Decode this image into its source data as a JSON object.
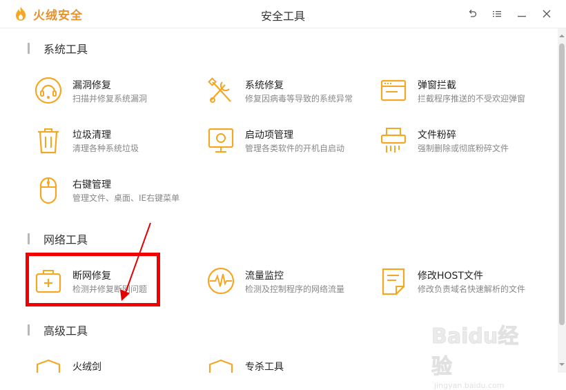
{
  "app": {
    "brand_name": "火绒安全",
    "window_title": "安全工具"
  },
  "titlebar": {
    "controls": [
      {
        "name": "back-icon"
      },
      {
        "name": "menu-icon"
      },
      {
        "name": "minimize-icon"
      },
      {
        "name": "close-icon"
      }
    ]
  },
  "sections": [
    {
      "title": "系统工具",
      "tools": [
        {
          "name": "漏洞修复",
          "desc": "扫描并修复系统漏洞",
          "icon": "vulnerability-fix-icon"
        },
        {
          "name": "系统修复",
          "desc": "修复因病毒等导致的系统异常",
          "icon": "tools-wrench-icon"
        },
        {
          "name": "弹窗拦截",
          "desc": "拦截程序推送的不受欢迎弹窗",
          "icon": "popup-window-icon"
        },
        {
          "name": "垃圾清理",
          "desc": "清理各种系统垃圾",
          "icon": "trash-icon"
        },
        {
          "name": "启动项管理",
          "desc": "管理各类软件的开机自启动",
          "icon": "monitor-icon"
        },
        {
          "name": "文件粉碎",
          "desc": "强制删除或彻底粉碎文件",
          "icon": "shredder-icon"
        },
        {
          "name": "右键管理",
          "desc": "管理文件、桌面、IE右键菜单",
          "icon": "mouse-icon"
        }
      ]
    },
    {
      "title": "网络工具",
      "tools": [
        {
          "name": "断网修复",
          "desc": "检测并修复断网问题",
          "icon": "toolbox-icon"
        },
        {
          "name": "流量监控",
          "desc": "检测及控制程序的网络流量",
          "icon": "traffic-pulse-icon"
        },
        {
          "name": "修改HOST文件",
          "desc": "修改负责域名快速解析的文件",
          "icon": "document-icon"
        }
      ]
    },
    {
      "title": "高级工具",
      "tools": [
        {
          "name": "火绒剑",
          "desc": "",
          "icon": "shield-icon"
        },
        {
          "name": "专杀工具",
          "desc": "",
          "icon": "shield-icon"
        }
      ]
    }
  ],
  "watermark": {
    "main": "Baidu经验",
    "sub": "jingyan.baidu.com"
  },
  "colors": {
    "accent": "#f5a623",
    "brand": "#e8922e",
    "highlight": "#f20000"
  }
}
